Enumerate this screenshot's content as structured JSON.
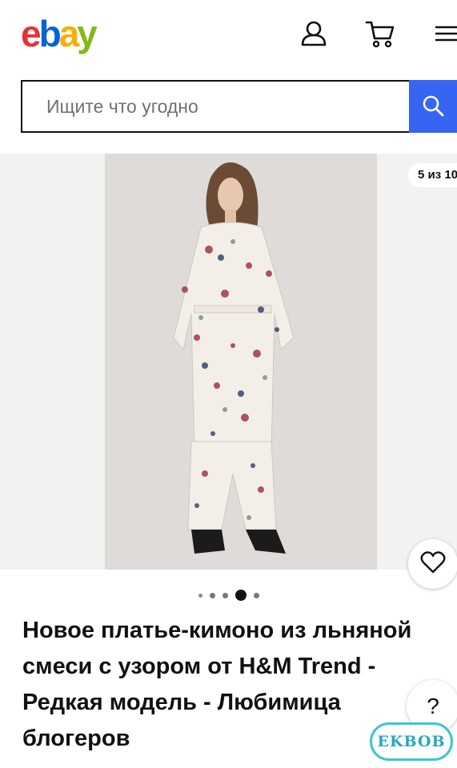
{
  "header": {
    "logo": {
      "e": "e",
      "b": "b",
      "a": "a",
      "y": "y"
    },
    "icons": [
      "user-icon",
      "cart-icon",
      "menu-icon"
    ]
  },
  "search": {
    "placeholder": "Ищите что угодно",
    "value": ""
  },
  "gallery": {
    "counter": "5 из 10",
    "active_index": 4,
    "dot_count": 5
  },
  "item": {
    "title": "Новое платье-кимоно из льняной смеси с узором от H&M Trend - Редкая модель - Любимица блогеров"
  },
  "help": {
    "label": "?"
  },
  "watermark": {
    "text": "EKBOB"
  },
  "colors": {
    "brand_red": "#e53238",
    "brand_blue": "#0064d2",
    "brand_yellow": "#f5af02",
    "brand_green": "#86b817",
    "search_button": "#3665f3"
  }
}
